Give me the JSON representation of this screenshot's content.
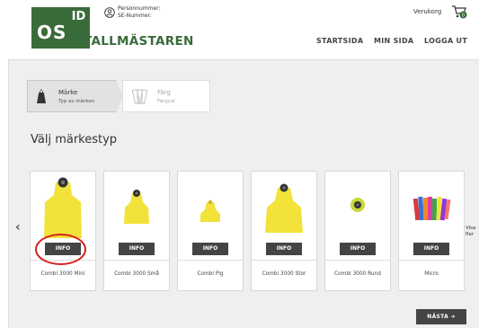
{
  "header": {
    "logo_os": "OS",
    "logo_id": "ID",
    "brand": "STALLMÄSTAREN",
    "person_line1": "Personnummer:",
    "person_line2": "SE-Nummer:",
    "cart_label": "Verukorg",
    "nav": {
      "start": "STARTSIDA",
      "min": "MIN SIDA",
      "logga": "LOGGA UT"
    }
  },
  "stepper": {
    "step1_title": "Märke",
    "step1_sub": "Typ av märken",
    "step2_title": "Färg",
    "step2_sub": "Färgval"
  },
  "page_title": "Välj märkestyp",
  "visa_fler": "Visa fler",
  "products": [
    {
      "label": "Combi 3000 Mini",
      "button": "INFO"
    },
    {
      "label": "Combi 3000 Små",
      "button": "INFO"
    },
    {
      "label": "Combi Pig",
      "button": "INFO"
    },
    {
      "label": "Combi 3000 Stor",
      "button": "INFO"
    },
    {
      "label": "Combi 3000 Rund",
      "button": "INFO"
    },
    {
      "label": "Micro",
      "button": "INFO"
    }
  ],
  "next_button": "NÄSTA",
  "colors": {
    "brand_green": "#3a6b3a",
    "tag_yellow": "#f2e23a",
    "highlight_red": "#d81e1e"
  }
}
